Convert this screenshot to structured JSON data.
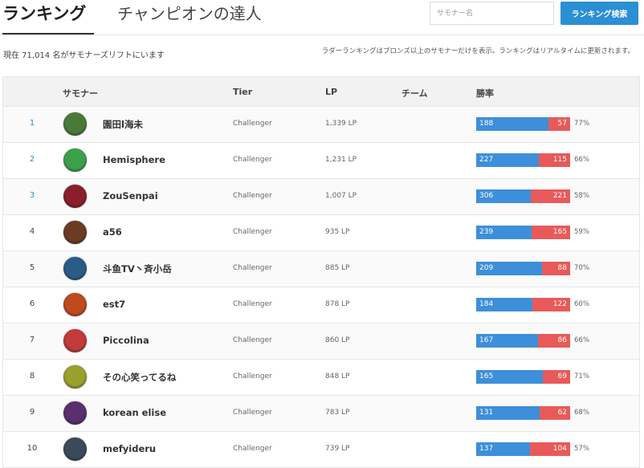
{
  "tabs": {
    "ranking": "ランキング",
    "champion": "チャンピオンの達人"
  },
  "search": {
    "placeholder": "サモナー名",
    "button": "ランキング検索"
  },
  "summary": {
    "count_text": "現在 71,014 名がサモナーズリフトにいます",
    "note": "ラダーランキングはブロンズ以上のサモナーだけを表示。ランキングはリアルタイムに更新されます。"
  },
  "table": {
    "headers": {
      "summoner": "サモナー",
      "tier": "Tier",
      "lp": "LP",
      "team": "チーム",
      "winrate": "勝率"
    },
    "rows": [
      {
        "rank": "1",
        "name": "園田l海未",
        "tier": "Challenger",
        "lp": "1,339 LP",
        "wins": "188",
        "losses": "57",
        "pct": "77%",
        "avatar": "#4a7a3a"
      },
      {
        "rank": "2",
        "name": "Hemisphere",
        "tier": "Challenger",
        "lp": "1,231 LP",
        "wins": "227",
        "losses": "115",
        "pct": "66%",
        "avatar": "#3aa14a"
      },
      {
        "rank": "3",
        "name": "ZouSenpai",
        "tier": "Challenger",
        "lp": "1,007 LP",
        "wins": "306",
        "losses": "221",
        "pct": "58%",
        "avatar": "#8a1f2a"
      },
      {
        "rank": "4",
        "name": "a56",
        "tier": "Challenger",
        "lp": "935 LP",
        "wins": "239",
        "losses": "165",
        "pct": "59%",
        "avatar": "#6b3b22"
      },
      {
        "rank": "5",
        "name": "斗鱼TV丶斉小岳",
        "tier": "Challenger",
        "lp": "885 LP",
        "wins": "209",
        "losses": "88",
        "pct": "70%",
        "avatar": "#2b5c88"
      },
      {
        "rank": "6",
        "name": "est7",
        "tier": "Challenger",
        "lp": "878 LP",
        "wins": "184",
        "losses": "122",
        "pct": "60%",
        "avatar": "#c04a1e"
      },
      {
        "rank": "7",
        "name": "Piccolina",
        "tier": "Challenger",
        "lp": "860 LP",
        "wins": "167",
        "losses": "86",
        "pct": "66%",
        "avatar": "#c23a3a"
      },
      {
        "rank": "8",
        "name": "その心笑ってるね",
        "tier": "Challenger",
        "lp": "848 LP",
        "wins": "165",
        "losses": "69",
        "pct": "71%",
        "avatar": "#9aa12a"
      },
      {
        "rank": "9",
        "name": "korean elise",
        "tier": "Challenger",
        "lp": "783 LP",
        "wins": "131",
        "losses": "62",
        "pct": "68%",
        "avatar": "#5a2f6e"
      },
      {
        "rank": "10",
        "name": "mefyideru",
        "tier": "Challenger",
        "lp": "739 LP",
        "wins": "137",
        "losses": "104",
        "pct": "57%",
        "avatar": "#3a4a5a"
      }
    ]
  },
  "colors": {
    "accent": "#2a8fd3",
    "win_bar": "#3d8fd9",
    "loss_bar": "#e85a5a"
  }
}
